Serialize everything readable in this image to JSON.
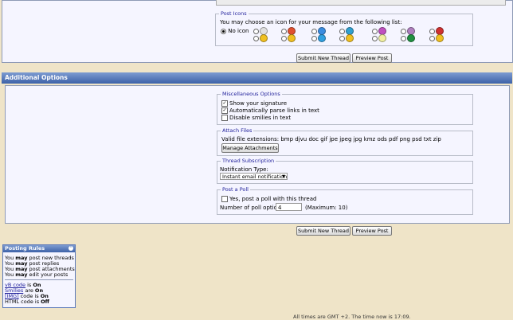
{
  "post_icons": {
    "legend": "Post Icons",
    "prompt": "You may choose an icon for your message from the following list:",
    "no_icon_label": "No icon",
    "icons": [
      "document-icon",
      "exclamation-icon",
      "question-icon",
      "cool-smile-icon",
      "angry-icon",
      "unhappy-icon",
      "thumbs-down-icon",
      "smile-icon",
      "wink-icon",
      "tongue-icon",
      "warning-icon",
      "lightbulb-icon",
      "arrow-icon",
      "thumbs-up-icon"
    ]
  },
  "buttons": {
    "submit": "Submit New Thread",
    "preview": "Preview Post"
  },
  "additional_options": {
    "title": "Additional Options",
    "misc": {
      "legend": "Miscellaneous Options",
      "options": [
        {
          "label": "Show your signature",
          "checked": true
        },
        {
          "label": "Automatically parse links in text",
          "checked": true
        },
        {
          "label": "Disable smilies in text",
          "checked": false
        }
      ]
    },
    "attach": {
      "legend": "Attach Files",
      "extensions": "Valid file extensions: bmp djvu doc gif jpe jpeg jpg kmz ods pdf png psd txt zip",
      "button": "Manage Attachments"
    },
    "subscription": {
      "legend": "Thread Subscription",
      "label": "Notification Type:",
      "selected": "Instant email notification"
    },
    "poll": {
      "legend": "Post a Poll",
      "checkbox_label": "Yes, post a poll with this thread",
      "options_label": "Number of poll options:",
      "options_value": "4",
      "max_note": "(Maximum: 10)"
    }
  },
  "posting_rules": {
    "title": "Posting Rules",
    "lines": [
      [
        "You ",
        "may",
        " post new threads"
      ],
      [
        "You ",
        "may",
        " post replies"
      ],
      [
        "You ",
        "may",
        " post attachments"
      ],
      [
        "You ",
        "may",
        " edit your posts"
      ]
    ],
    "codes": [
      {
        "link": "vB code",
        "text": " is ",
        "state": "On"
      },
      {
        "link": "Smilies",
        "text": " are ",
        "state": "On"
      },
      {
        "link": "[IMG]",
        "text": " code is ",
        "state": "On"
      },
      {
        "link": "",
        "text": "HTML code is ",
        "state": "Off"
      }
    ]
  },
  "footer": {
    "timezone": "All times are GMT +2. The time now is 17:09."
  },
  "colors": {
    "header": "#3d62a8",
    "page_bg": "#efe4c8",
    "panel_bg": "#f5f5ff",
    "legend": "#22229c"
  }
}
